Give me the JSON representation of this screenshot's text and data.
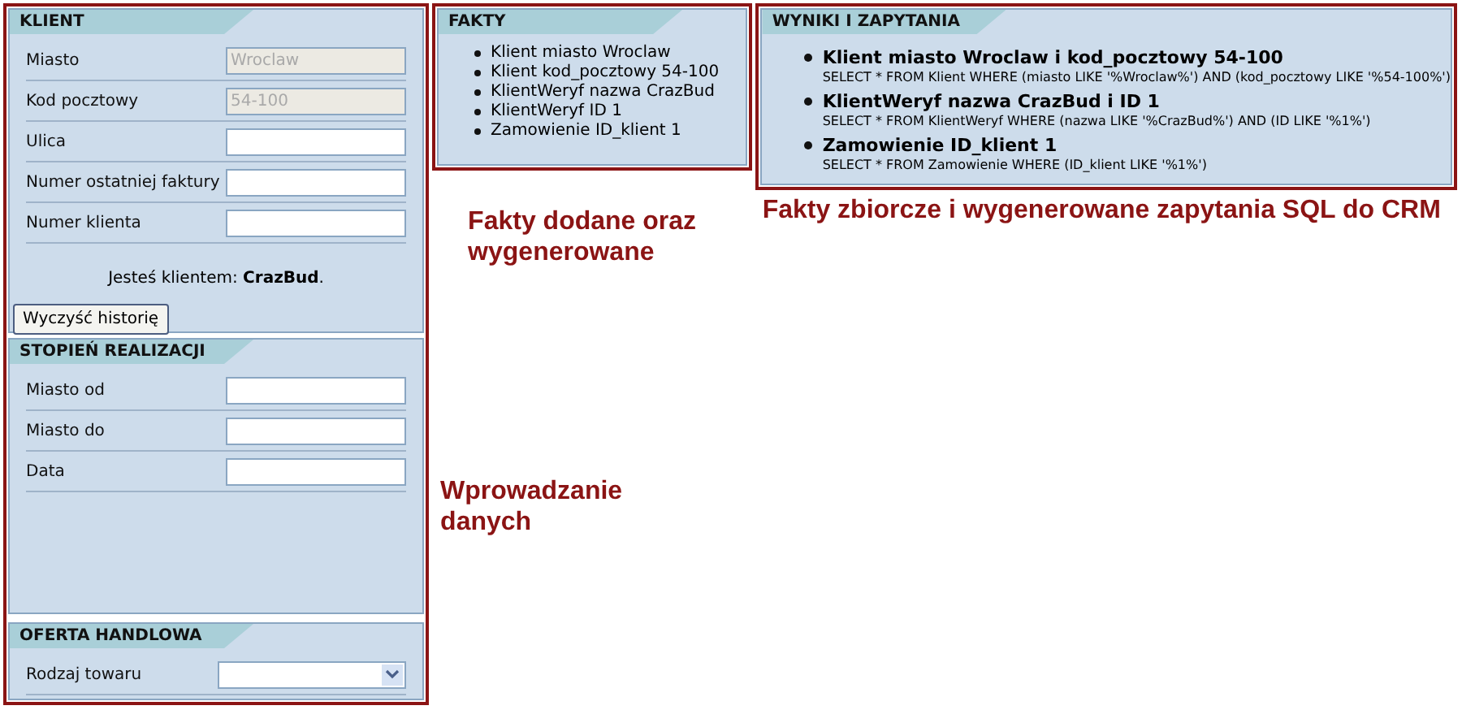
{
  "klient": {
    "title": "KLIENT",
    "fields": [
      {
        "label": "Miasto",
        "kind": "text",
        "value": "Wroclaw",
        "disabled": true
      },
      {
        "label": "Kod pocztowy",
        "kind": "text",
        "value": "54-100",
        "disabled": true
      },
      {
        "label": "Ulica",
        "kind": "text",
        "disabled": false
      },
      {
        "label": "Numer ostatniej faktury",
        "kind": "text",
        "disabled": false
      },
      {
        "label": "Numer klienta",
        "kind": "text",
        "disabled": false
      }
    ],
    "client_text": "Jesteś klientem: **CrazBud**.",
    "button": "Wyczyść historię"
  },
  "stopien_realizacji": {
    "title": "STOPIEŃ REALIZACJI",
    "fields": [
      {
        "label": "Miasto od",
        "kind": "text",
        "disabled": false
      },
      {
        "label": "Miasto do",
        "kind": "text",
        "disabled": false
      },
      {
        "label": "Data",
        "kind": "text",
        "disabled": false
      }
    ]
  },
  "oferta_handlowa": {
    "title": "OFERTA HANDLOWA",
    "fields": [
      {
        "label": "Rodzaj towaru",
        "kind": "select",
        "disabled": false
      }
    ]
  },
  "fakty": {
    "title": "FAKTY",
    "items": [
      "Klient miasto Wroclaw",
      "Klient kod_pocztowy 54-100",
      "KlientWeryf nazwa CrazBud",
      "KlientWeryf ID 1",
      "Zamowienie ID_klient 1"
    ]
  },
  "wyniki": {
    "title": "WYNIKI I ZAPYTANIA",
    "items": [
      {
        "fact": "Klient miasto Wroclaw i kod_pocztowy 54-100",
        "query": "SELECT * FROM Klient WHERE (miasto LIKE '%Wroclaw%') AND (kod_pocztowy LIKE '%54-100%')"
      },
      {
        "fact": "KlientWeryf nazwa CrazBud i ID 1",
        "query": "SELECT * FROM KlientWeryf WHERE (nazwa LIKE '%CrazBud%') AND (ID LIKE '%1%')"
      },
      {
        "fact": "Zamowienie ID_klient 1",
        "query": "SELECT * FROM Zamowienie WHERE (ID_klient LIKE '%1%')"
      }
    ]
  },
  "annotations": {
    "fakty": "Fakty dodane oraz wygenerowane",
    "wyniki": "Fakty zbiorcze i wygenerowane zapytania SQL do CRM",
    "dane": "Wprowadzanie danych"
  }
}
